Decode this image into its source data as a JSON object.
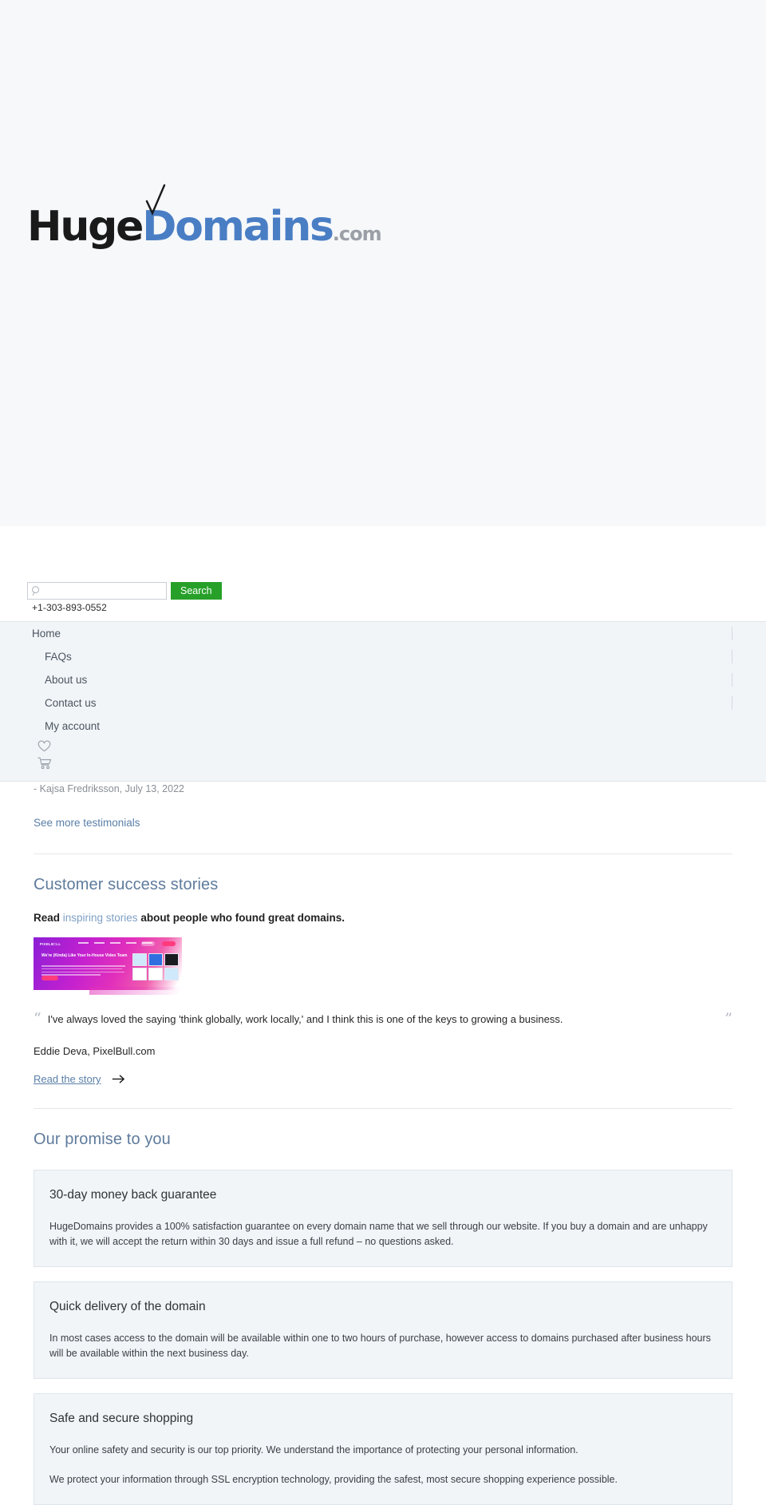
{
  "brand": {
    "logo_huge": "Huge",
    "logo_domains": "Domains",
    "logo_com": ".com",
    "check_icon": "checkmark-icon"
  },
  "search": {
    "value": "",
    "placeholder": "",
    "button_label": "Search",
    "icon": "search-icon",
    "accent_color": "#27a02a"
  },
  "contact": {
    "phone": "+1-303-893-0552"
  },
  "nav": {
    "items": [
      {
        "label": "Home",
        "level": "root"
      },
      {
        "label": "FAQs",
        "level": "sub"
      },
      {
        "label": "About us",
        "level": "sub"
      },
      {
        "label": "Contact us",
        "level": "sub"
      },
      {
        "label": "My account",
        "level": "sub"
      }
    ],
    "icons": [
      {
        "name": "heart-icon",
        "label": "Favorites"
      },
      {
        "name": "cart-icon",
        "label": "Cart"
      }
    ]
  },
  "testimonial": {
    "attribution": "- Kajsa Fredriksson, July 13, 2022",
    "see_more_label": "See more testimonials"
  },
  "success_stories": {
    "title": "Customer success stories",
    "lede_before": "Read ",
    "lede_link": "inspiring stories",
    "lede_after": " about people who found great domains.",
    "thumbnail": {
      "name": "pixelbull-site-screenshot",
      "brand": "PIXELB=LL",
      "headline": "We're (Kinda) Like Your In-House Video Team",
      "accent_color": "#e230bb"
    },
    "quote_open": "“",
    "quote_close": "”",
    "quote": "I've always loved the saying 'think globally, work locally,' and I think this is one of the keys to growing a business.",
    "author": "Eddie Deva, PixelBull.com",
    "read_story_label": "Read the story",
    "read_story_arrow": "arrow-right-icon"
  },
  "promise": {
    "title": "Our promise to you",
    "cards": [
      {
        "title": "30-day money back guarantee",
        "paragraphs": [
          "HugeDomains provides a 100% satisfaction guarantee on every domain name that we sell through our website. If you buy a domain and are unhappy with it, we will accept the return within 30 days and issue a full refund – no questions asked."
        ]
      },
      {
        "title": "Quick delivery of the domain",
        "paragraphs": [
          "In most cases access to the domain will be available within one to two hours of purchase, however access to domains purchased after business hours will be available within the next business day."
        ]
      },
      {
        "title": "Safe and secure shopping",
        "paragraphs": [
          "Your online safety and security is our top priority. We understand the importance of protecting your personal information.",
          "We protect your information through SSL encryption technology, providing the safest, most secure shopping experience possible."
        ]
      }
    ]
  }
}
